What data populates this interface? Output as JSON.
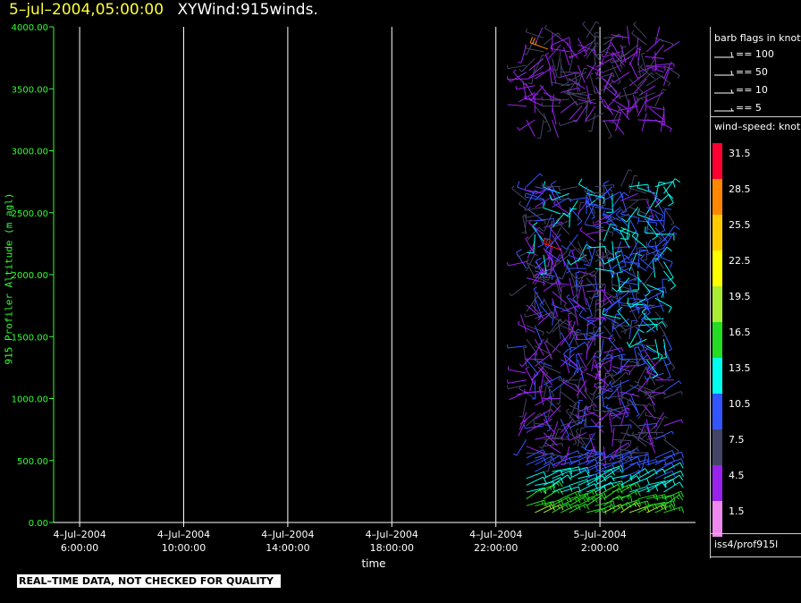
{
  "header": {
    "date_label": "5–jul–2004,05:00:00",
    "title": "XYWind:915winds."
  },
  "chart_data": {
    "type": "scatter",
    "subtype": "wind-barb time-height plot",
    "title": "XYWind:915winds.",
    "timestamp": "5–jul–2004,05:00:00",
    "xlabel": "time",
    "ylabel": "915 Profiler Altitude (m agl)",
    "ylim": [
      0,
      4000
    ],
    "y_ticks": [
      "0.00",
      "500.00",
      "1000.00",
      "1500.00",
      "2000.00",
      "2500.00",
      "3000.00",
      "3500.00",
      "4000.00"
    ],
    "x_ticks": [
      {
        "date": "4–Jul–2004",
        "time": "6:00:00"
      },
      {
        "date": "4–Jul–2004",
        "time": "10:00:00"
      },
      {
        "date": "4–Jul–2004",
        "time": "14:00:00"
      },
      {
        "date": "4–Jul–2004",
        "time": "18:00:00"
      },
      {
        "date": "4–Jul–2004",
        "time": "22:00:00"
      },
      {
        "date": "5–Jul–2004",
        "time": "2:00:00"
      }
    ],
    "x_range_hours": [
      "4-Jul-2004 5:00:00",
      "5-Jul-2004 5:00:00"
    ],
    "data_window": [
      "4-Jul-2004 23:00:00",
      "5-Jul-2004 4:00:00"
    ],
    "grid": "vertical lines at x ticks",
    "profile_rows": [
      {
        "alt_range": [
          80,
          560
        ],
        "speed_knots": [
          8,
          17
        ],
        "direction": "southwest"
      },
      {
        "alt_range": [
          560,
          1150
        ],
        "speed_knots": [
          4,
          10
        ],
        "direction": "mixed"
      },
      {
        "alt_range": [
          1150,
          2050
        ],
        "speed_knots": [
          3,
          11
        ],
        "direction": "mixed"
      },
      {
        "alt_range": [
          2050,
          2750
        ],
        "speed_knots": [
          3,
          14
        ],
        "direction": "mixed"
      },
      {
        "alt_range": [
          3250,
          3950
        ],
        "speed_knots": [
          3,
          8
        ],
        "direction": "mixed"
      }
    ],
    "highlight_barbs": [
      {
        "time": "5-Jul-2004 0:30:00",
        "alt": 2200,
        "speed_knots": 31,
        "color": "#ff2020"
      },
      {
        "time": "5-Jul-2004 0:00:00",
        "alt": 3820,
        "speed_knots": 27,
        "color": "#ff8800"
      }
    ]
  },
  "legend": {
    "barb_title": "barb flags in knots",
    "barb_flags": [
      "== 100",
      "== 50",
      "== 10",
      "== 5"
    ],
    "speed_title": "wind–speed: knots",
    "colorbar": [
      {
        "label": "31.5",
        "color": "#ff0033"
      },
      {
        "label": "28.5",
        "color": "#ff8800"
      },
      {
        "label": "25.5",
        "color": "#ffcc00"
      },
      {
        "label": "22.5",
        "color": "#ffff00"
      },
      {
        "label": "19.5",
        "color": "#aaee33"
      },
      {
        "label": "16.5",
        "color": "#22dd22"
      },
      {
        "label": "13.5",
        "color": "#00ffee"
      },
      {
        "label": "10.5",
        "color": "#3355ff"
      },
      {
        "label": "7.5",
        "color": "#444466"
      },
      {
        "label": "4.5",
        "color": "#9922ee"
      },
      {
        "label": "1.5",
        "color": "#ee88ee"
      }
    ],
    "source_id": "iss4/prof915l"
  },
  "footer": {
    "disclaimer": "REAL–TIME DATA, NOT CHECKED FOR QUALITY"
  },
  "colors": {
    "axis": "#33ff33",
    "title_date": "#ffff33",
    "grid": "#ffffff"
  }
}
